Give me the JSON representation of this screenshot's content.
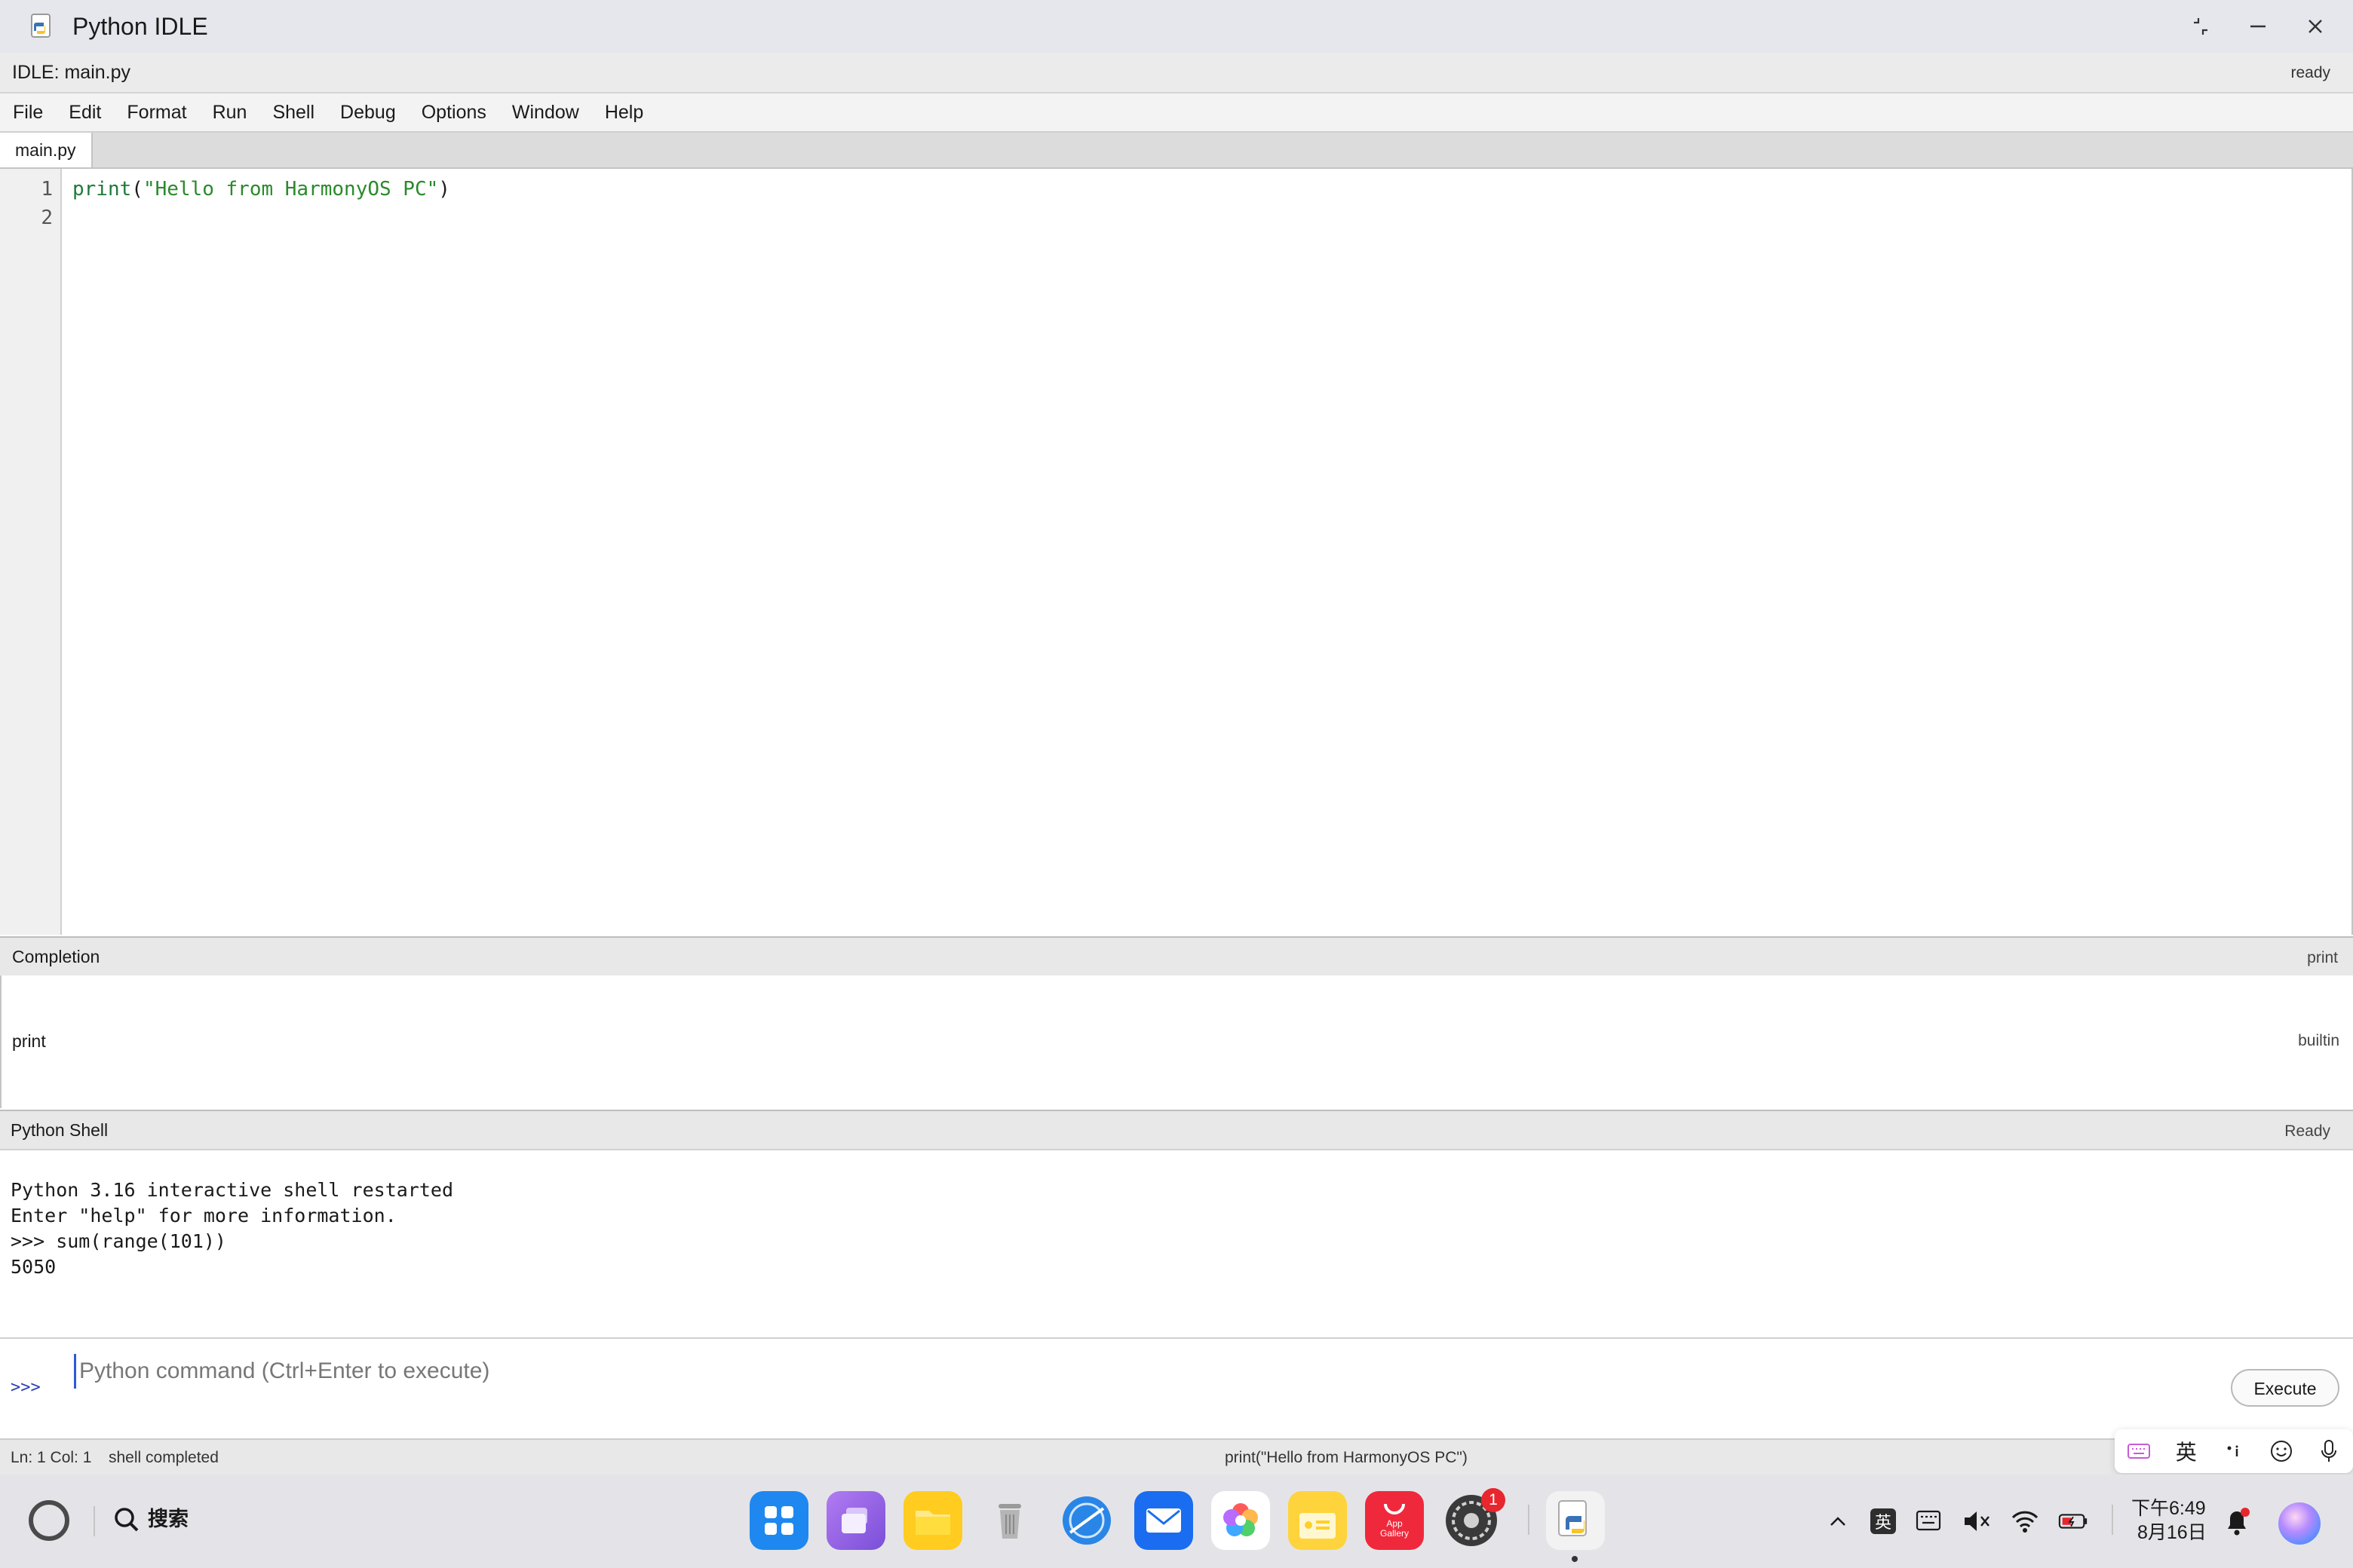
{
  "window": {
    "title": "Python IDLE",
    "controls": [
      "restore-icon",
      "minimize-icon",
      "close-icon"
    ]
  },
  "idle_header": {
    "title": "IDLE: main.py",
    "status": "ready"
  },
  "menu": [
    "File",
    "Edit",
    "Format",
    "Run",
    "Shell",
    "Debug",
    "Options",
    "Window",
    "Help"
  ],
  "tabs": [
    {
      "label": "main.py",
      "active": true
    }
  ],
  "editor": {
    "line_numbers": [
      "1",
      "2"
    ],
    "code": {
      "func": "print",
      "open": "(",
      "string": "\"Hello from HarmonyOS PC\"",
      "close": ")"
    }
  },
  "completion": {
    "title": "Completion",
    "current": "print",
    "items": [
      {
        "name": "print",
        "kind": "builtin"
      }
    ]
  },
  "shell": {
    "title": "Python Shell",
    "status": "Ready",
    "output": "Python 3.16 interactive shell restarted\nEnter \"help\" for more information.\n>>> sum(range(101))\n5050",
    "prompt": ">>>",
    "input_value": "",
    "input_placeholder": "Python command (Ctrl+Enter to execute)",
    "execute_label": "Execute"
  },
  "statusbar": {
    "position": "Ln: 1 Col: 1",
    "message": "shell completed",
    "current_code": "print(\"Hello from HarmonyOS PC\")"
  },
  "ime": {
    "items": [
      "keyboard-icon",
      "英",
      "punctuation-icon",
      "emoji-icon",
      "microphone-icon"
    ],
    "mode_label": "英"
  },
  "taskbar": {
    "search_label": "搜索",
    "dock": [
      "app-launcher-icon",
      "multitask-icon",
      "files-icon",
      "trash-icon",
      "browser-icon",
      "mail-icon",
      "gallery-icon",
      "notes-icon",
      "appgallery-icon",
      "settings-icon",
      "python-idle-icon"
    ],
    "appgallery_label": "App Gallery",
    "settings_badge": "1",
    "tray_ime_label": "英",
    "time": "下午6:49",
    "date": "8月16日"
  },
  "colors": {
    "accent": "#2a5bd7",
    "code_green": "#1e7a3a",
    "badge_red": "#e8262d"
  }
}
